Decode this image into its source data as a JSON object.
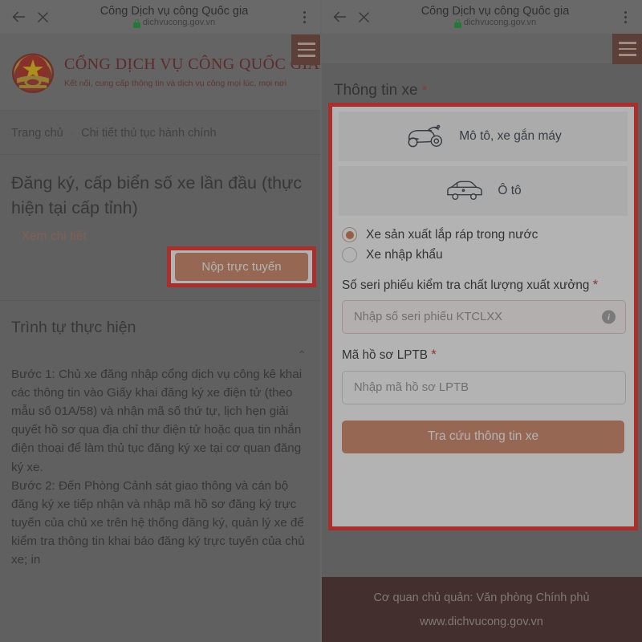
{
  "browser": {
    "title": "Cổng Dịch vụ công Quốc gia",
    "url": "dichvucong.gov.vn",
    "back_icon": "back-arrow-icon",
    "close_icon": "close-icon",
    "menu_icon": "kebab-menu-icon",
    "lock_icon": "lock-icon"
  },
  "site": {
    "brand_title": "CỔNG DỊCH VỤ CÔNG QUỐC GIA",
    "brand_sub": "Kết nối, cung cấp thông tin và dịch vụ công mọi lúc, mọi nơi",
    "emblem": "vietnam-emblem-icon",
    "hamburger": "hamburger-menu-icon"
  },
  "left": {
    "breadcrumb": {
      "home": "Trang chủ",
      "separator": "›",
      "current": "Chi tiết thủ tục hành chính"
    },
    "doc_title": "Đăng ký, cấp biển số xe lần đầu (thực hiện tại cấp tỉnh)",
    "see_detail": "Xem chi tiết",
    "see_detail_chevron": "›",
    "submit_button": "Nộp trực tuyến",
    "section_title": "Trình tự thực hiện",
    "collapse_chevron": "⌃",
    "step1": "Bước 1: Chủ xe đăng nhập cổng dịch vụ công kê khai các thông tin vào Giấy khai đăng ký xe điện tử (theo mẫu số 01A/58) và nhận mã số thứ tự, lịch hẹn giải quyết hồ sơ qua địa chỉ thư điện tử hoặc qua tin nhắn điện thoại để làm thủ tục đăng ký xe tại cơ quan đăng ký xe.",
    "step2": "Bước 2: Đến Phòng Cảnh sát giao thông và cán bộ đăng ký xe tiếp nhận và nhập mã hồ sơ đăng ký trực tuyến của chủ xe trên hệ thống đăng ký, quản lý xe để kiểm tra thông tin khai báo đăng ký trực tuyến của chủ xe; in"
  },
  "right": {
    "form_heading": "Thông tin xe",
    "required_mark": "*",
    "vehicle_options": [
      {
        "label": "Mô tô, xe gắn máy",
        "icon": "scooter-icon"
      },
      {
        "label": "Ô tô",
        "icon": "car-icon"
      }
    ],
    "radios": [
      {
        "label": "Xe sản xuất lắp ráp trong nước",
        "selected": true
      },
      {
        "label": "Xe nhập khẩu",
        "selected": false
      }
    ],
    "field_serial": {
      "label": "Số seri phiếu kiểm tra chất lượng xuất xưởng",
      "required": "*",
      "placeholder": "Nhập số seri phiếu KTCLXX",
      "value": "",
      "info_icon": "info-icon"
    },
    "field_lptb": {
      "label": "Mã hồ sơ LPTB",
      "required": "*",
      "placeholder": "Nhập mã hồ sơ LPTB",
      "value": ""
    },
    "lookup_button": "Tra cứu thông tin xe"
  },
  "footer": {
    "line1": "Cơ quan chủ quản: Văn phòng Chính phủ",
    "line2": "www.dichvucong.gov.vn"
  },
  "colors": {
    "highlight": "#ed1c16",
    "accent": "#cd7d5a",
    "brand_dark_red": "#6d1512",
    "footer_bg": "#3d1c1a"
  }
}
